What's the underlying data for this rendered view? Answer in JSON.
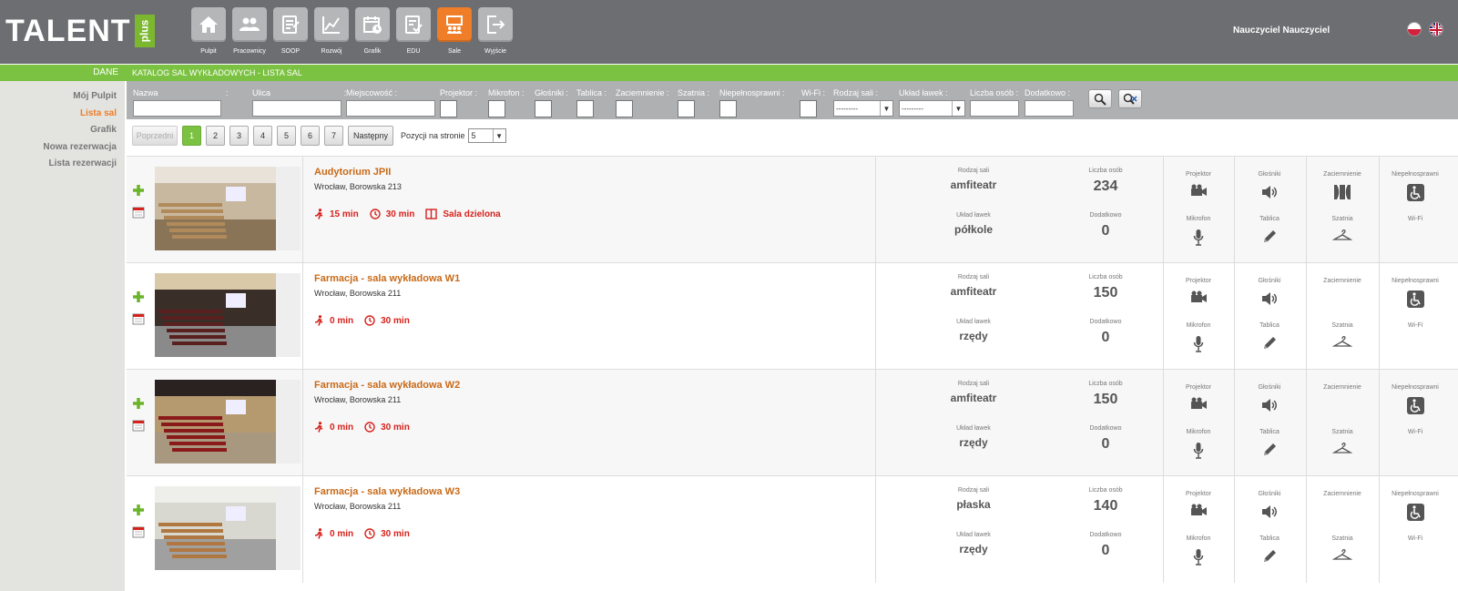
{
  "header": {
    "logo_text": "TALENT",
    "logo_plus": "plus",
    "user_name": "Nauczyciel Nauczyciel",
    "nav": [
      {
        "label": "Pulpit",
        "icon": "home-icon"
      },
      {
        "label": "Pracownicy",
        "icon": "users-icon"
      },
      {
        "label": "SOOP",
        "icon": "document-icon"
      },
      {
        "label": "Rozwój",
        "icon": "chart-icon"
      },
      {
        "label": "Grafik",
        "icon": "calendar-icon"
      },
      {
        "label": "EDU",
        "icon": "edu-icon"
      },
      {
        "label": "Sale",
        "icon": "presentation-icon",
        "active": true
      },
      {
        "label": "Wyjście",
        "icon": "exit-icon"
      }
    ]
  },
  "green_bar": {
    "left_label": "DANE",
    "title": "KATALOG SAL WYKŁADOWYCH - LISTA SAL"
  },
  "sidebar": {
    "items": [
      {
        "label": "Mój Pulpit",
        "active": false
      },
      {
        "label": "Lista sal",
        "active": true
      },
      {
        "label": "Grafik",
        "active": false
      },
      {
        "label": "Nowa rezerwacja",
        "active": false
      },
      {
        "label": "Lista rezerwacji",
        "active": false
      }
    ]
  },
  "filters": {
    "nazwa": "Nazwa",
    "ulica": "Ulica",
    "miejscowosc": "Miejscowość",
    "projektor": "Projektor",
    "mikrofon": "Mikrofon",
    "glosniki": "Głośniki",
    "tablica": "Tablica",
    "zaciemnienie": "Zaciemnienie",
    "szatnia": "Szatnia",
    "niepelnosprawni": "Niepełnosprawni",
    "wifi": "Wi-Fi",
    "rodzaj_sali": "Rodzaj sali",
    "uklad_lawek": "Układ ławek",
    "liczba_osob": "Liczba osób",
    "dodatkowo": "Dodatkowo",
    "select_placeholder": "---------",
    "colon": ":"
  },
  "pager": {
    "prev": "Poprzedni",
    "next": "Następny",
    "pages": [
      "1",
      "2",
      "3",
      "4",
      "5",
      "6",
      "7"
    ],
    "current": "1",
    "per_page_label": "Pozycji na stronie",
    "per_page_value": "5"
  },
  "labels": {
    "rodzaj_sali": "Rodzaj sali",
    "liczba_osob": "Liczba osób",
    "uklad_lawek": "Układ ławek",
    "dodatkowo": "Dodatkowo",
    "projektor": "Projektor",
    "mikrofon": "Mikrofon",
    "glosniki": "Głośniki",
    "tablica": "Tablica",
    "zaciemnienie": "Zaciemnienie",
    "szatnia": "Szatnia",
    "niepelnosprawni": "Niepełnosprawni",
    "wifi": "Wi-Fi"
  },
  "rooms": [
    {
      "name": "Audytorium JPII",
      "address": "Wrocław, Borowska 213",
      "walk": "15 min",
      "time": "30 min",
      "shared": "Sala dzielona",
      "rodzaj": "amfiteatr",
      "liczba": "234",
      "uklad": "półkole",
      "dodatkowo": "0",
      "zaciemnienie": true,
      "niepelnosprawni": true
    },
    {
      "name": "Farmacja - sala wykładowa W1",
      "address": "Wrocław, Borowska 211",
      "walk": "0 min",
      "time": "30 min",
      "shared": "",
      "rodzaj": "amfiteatr",
      "liczba": "150",
      "uklad": "rzędy",
      "dodatkowo": "0",
      "zaciemnienie": false,
      "niepelnosprawni": true
    },
    {
      "name": "Farmacja - sala wykładowa W2",
      "address": "Wrocław, Borowska 211",
      "walk": "0 min",
      "time": "30 min",
      "shared": "",
      "rodzaj": "amfiteatr",
      "liczba": "150",
      "uklad": "rzędy",
      "dodatkowo": "0",
      "zaciemnienie": false,
      "niepelnosprawni": true
    },
    {
      "name": "Farmacja - sala wykładowa W3",
      "address": "Wrocław, Borowska 211",
      "walk": "0 min",
      "time": "30 min",
      "shared": "",
      "rodzaj": "płaska",
      "liczba": "140",
      "uklad": "rzędy",
      "dodatkowo": "0",
      "zaciemnienie": false,
      "niepelnosprawni": true
    }
  ],
  "colors": {
    "header_bg": "#6d6e72",
    "accent_green": "#7cc242",
    "accent_orange": "#f07d28",
    "room_name": "#c96a18",
    "meta_red": "#d6221c"
  }
}
